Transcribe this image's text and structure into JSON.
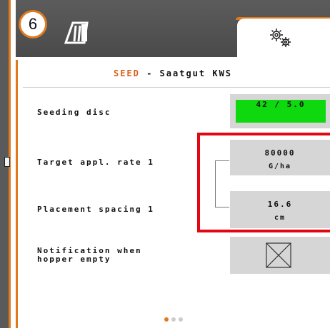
{
  "header": {
    "page_number": "6",
    "machine_icon": "seed-drill-icon",
    "settings_icon": "gears-icon"
  },
  "title": {
    "highlight": "SEED",
    "rest": " - Saatgut KWS"
  },
  "rows": {
    "seeding_disc": {
      "label": "Seeding disc",
      "value": "42 / 5.0"
    },
    "target_rate": {
      "label": "Target appl. rate 1",
      "value": "80000",
      "unit": "G/ha"
    },
    "placement": {
      "label": "Placement spacing 1",
      "value": "16.6",
      "unit": "cm"
    },
    "notification": {
      "label_line1": "Notification when",
      "label_line2": "hopper empty",
      "checked": true
    }
  },
  "pager": {
    "pages": 3,
    "current": 1
  },
  "colors": {
    "accent": "#e07a1f",
    "highlight_frame": "#e30613",
    "seeding_disc_ok": "#0ed80e",
    "value_box": "#d6d6d6"
  }
}
